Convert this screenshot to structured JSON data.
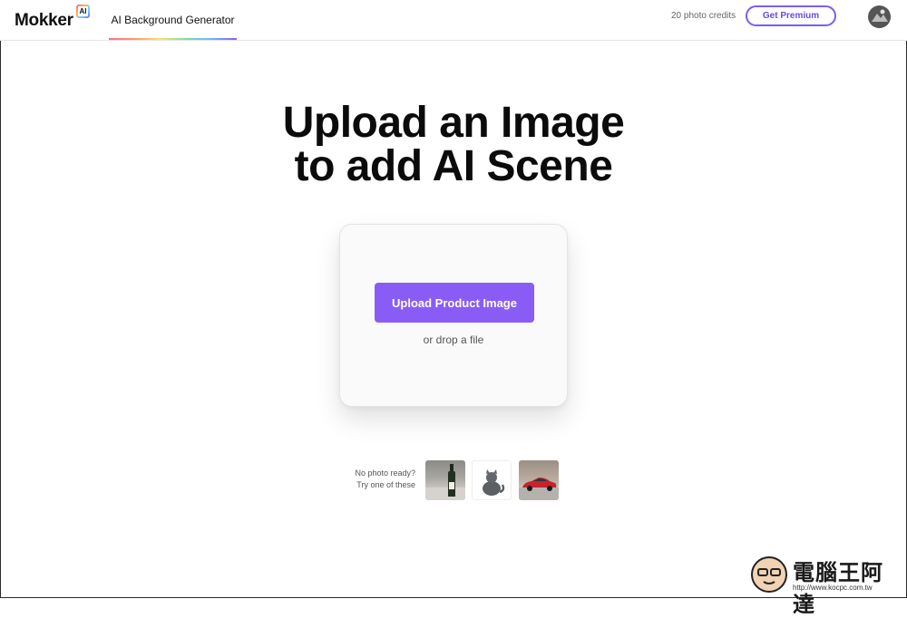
{
  "header": {
    "logo_text": "Mokker",
    "logo_badge": "AI",
    "nav_tab": "AI Background Generator",
    "credits": "20 photo credits",
    "premium_label": "Get Premium"
  },
  "hero": {
    "line1": "Upload an Image",
    "line2": "to add AI Scene"
  },
  "upload": {
    "button_label": "Upload Product Image",
    "drop_text": "or drop a file"
  },
  "samples": {
    "line1": "No photo ready?",
    "line2": "Try one of these",
    "items": [
      "wine-bottle-sample",
      "cat-sample",
      "red-car-sample"
    ]
  },
  "watermark": {
    "title": "電腦王阿達",
    "url": "http://www.kocpc.com.tw"
  },
  "colors": {
    "accent": "#8a5cf6",
    "premium_border": "#7c5cf0"
  }
}
